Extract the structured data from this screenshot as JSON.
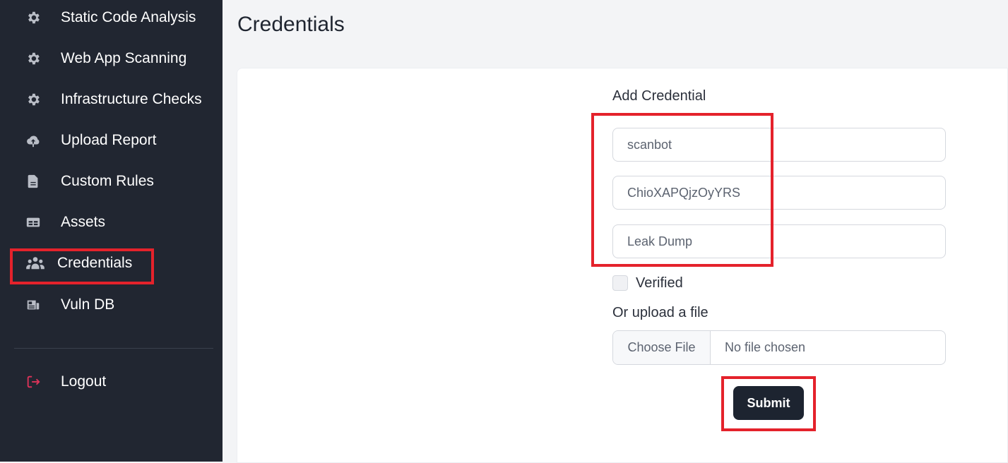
{
  "sidebar": {
    "items": [
      {
        "label": "Static Code Analysis",
        "icon": "gear-icon"
      },
      {
        "label": "Web App Scanning",
        "icon": "gear-icon"
      },
      {
        "label": "Infrastructure Checks",
        "icon": "gear-icon"
      },
      {
        "label": "Upload Report",
        "icon": "cloud-upload-icon"
      },
      {
        "label": "Custom Rules",
        "icon": "document-icon"
      },
      {
        "label": "Assets",
        "icon": "table-icon"
      },
      {
        "label": "Credentials",
        "icon": "users-icon",
        "active": true
      },
      {
        "label": "Vuln DB",
        "icon": "news-icon"
      }
    ],
    "logout": {
      "label": "Logout",
      "icon": "logout-icon"
    }
  },
  "page": {
    "title": "Credentials"
  },
  "form": {
    "heading": "Add Credential",
    "username_value": "scanbot",
    "password_value": "ChioXAPQjzOyYRS",
    "source_value": "Leak Dump",
    "verified_label": "Verified",
    "verified_checked": false,
    "upload_label": "Or upload a file",
    "choose_file_label": "Choose File",
    "file_status": "No file chosen",
    "submit_label": "Submit"
  },
  "colors": {
    "sidebar_bg": "#212631",
    "highlight_red": "#e4222b",
    "logout_icon": "#e0335a",
    "submit_bg": "#1d2430"
  }
}
